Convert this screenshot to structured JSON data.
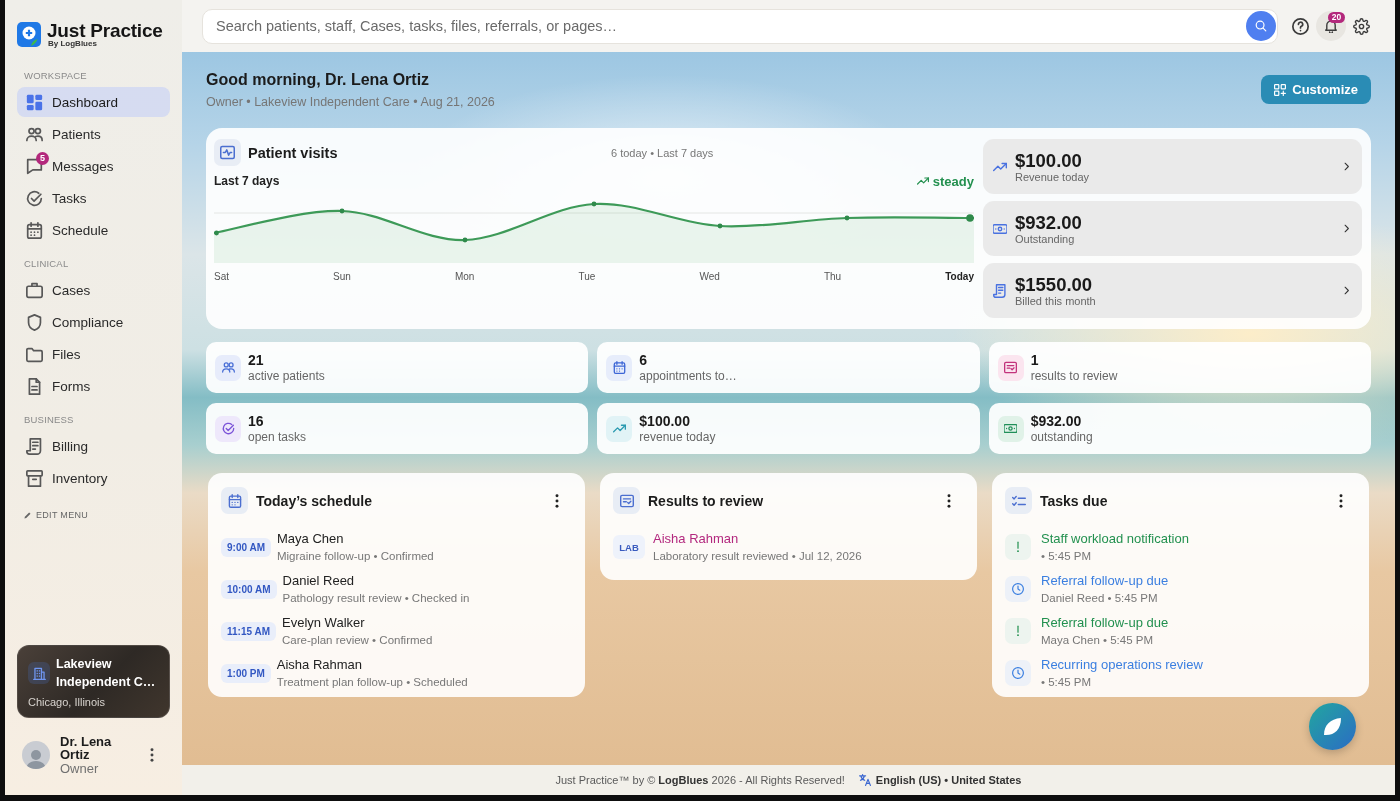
{
  "sidebar": {
    "brand": {
      "name": "Just Practice",
      "byline": "By LogBlues"
    },
    "sections": [
      {
        "title": "WORKSPACE",
        "items": [
          {
            "kind": "dashboard",
            "label": "Dashboard",
            "selected": true
          },
          {
            "kind": "patients",
            "label": "Patients",
            "selected": false
          },
          {
            "kind": "messages",
            "label": "Messages",
            "badge": "5",
            "selected": false
          },
          {
            "kind": "tasks",
            "label": "Tasks",
            "selected": false
          },
          {
            "kind": "schedule",
            "label": "Schedule",
            "selected": false
          }
        ]
      },
      {
        "title": "CLINICAL",
        "items": [
          {
            "kind": "cases",
            "label": "Cases",
            "selected": false
          },
          {
            "kind": "compliance",
            "label": "Compliance",
            "selected": false
          },
          {
            "kind": "files",
            "label": "Files",
            "selected": false
          },
          {
            "kind": "forms",
            "label": "Forms",
            "selected": false
          }
        ]
      },
      {
        "title": "BUSINESS",
        "items": [
          {
            "kind": "billing",
            "label": "Billing",
            "selected": false
          },
          {
            "kind": "inventory",
            "label": "Inventory",
            "selected": false
          }
        ]
      }
    ],
    "edit_menu": "EDIT MENU",
    "clinic": {
      "name": "Lakeview Independent C…",
      "location": "Chicago, Illinois"
    },
    "user": {
      "name": "Dr. Lena Ortiz",
      "role": "Owner"
    }
  },
  "topbar": {
    "search": {
      "placeholder": "Search patients, staff, Cases, tasks, files, referrals, or pages…"
    },
    "notifications": "20"
  },
  "header": {
    "greeting": "Good morning, Dr. Lena Ortiz",
    "subtitle": "Owner • Lakeview Independent Care • Aug 21, 2026",
    "action": "Customize"
  },
  "visits": {
    "title": "Patient visits",
    "summary": "6 today • Last 7 days",
    "range": "Last 7 days",
    "trend": "steady",
    "x_labels": [
      {
        "label": "Sat",
        "current": false
      },
      {
        "label": "Sun",
        "current": false
      },
      {
        "label": "Mon",
        "current": false
      },
      {
        "label": "Tue",
        "current": false
      },
      {
        "label": "Wed",
        "current": false
      },
      {
        "label": "Thu",
        "current": false
      },
      {
        "label": "Today",
        "current": true
      }
    ]
  },
  "metrics": [
    {
      "kind": "revenue",
      "amount": "$100.00",
      "label": "Revenue today"
    },
    {
      "kind": "outstanding",
      "amount": "$932.00",
      "label": "Outstanding"
    },
    {
      "kind": "billed",
      "amount": "$1550.00",
      "label": "Billed this month"
    }
  ],
  "stats": [
    {
      "kind": "patients",
      "value": "21",
      "label": "active patients"
    },
    {
      "kind": "appointments",
      "value": "6",
      "label": "appointments to…"
    },
    {
      "kind": "results",
      "value": "1",
      "label": "results to review"
    },
    {
      "kind": "tasks",
      "value": "16",
      "label": "open tasks"
    },
    {
      "kind": "revenue",
      "value": "$100.00",
      "label": "revenue today"
    },
    {
      "kind": "outstanding",
      "value": "$932.00",
      "label": "outstanding"
    }
  ],
  "schedule": {
    "title": "Today’s schedule",
    "items": [
      {
        "time": "9:00 AM",
        "name": "Maya Chen",
        "detail": "Migraine follow-up • Confirmed"
      },
      {
        "time": "10:00 AM",
        "name": "Daniel Reed",
        "detail": "Pathology result review • Checked in"
      },
      {
        "time": "11:15 AM",
        "name": "Evelyn Walker",
        "detail": "Care-plan review • Confirmed"
      },
      {
        "time": "1:00 PM",
        "name": "Aisha Rahman",
        "detail": "Treatment plan follow-up • Scheduled"
      }
    ]
  },
  "results": {
    "title": "Results to review",
    "items": [
      {
        "tag": "LAB",
        "name": "Aisha Rahman",
        "detail": "Laboratory result reviewed • Jul 12, 2026"
      }
    ]
  },
  "tasks": {
    "title": "Tasks due",
    "items": [
      {
        "kind": "priority",
        "title": "Staff workload notification",
        "detail": "• 5:45 PM"
      },
      {
        "kind": "scheduled",
        "title": "Referral follow-up due",
        "detail": "Daniel Reed • 5:45 PM"
      },
      {
        "kind": "priority",
        "title": "Referral follow-up due",
        "detail": "Maya Chen • 5:45 PM"
      },
      {
        "kind": "scheduled",
        "title": "Recurring operations review",
        "detail": "• 5:45 PM"
      }
    ]
  },
  "footer": {
    "copyright": "Just Practice™ by © **LogBlues** 2026 - All Rights Reserved!",
    "locale": "English (US) • United States"
  }
}
